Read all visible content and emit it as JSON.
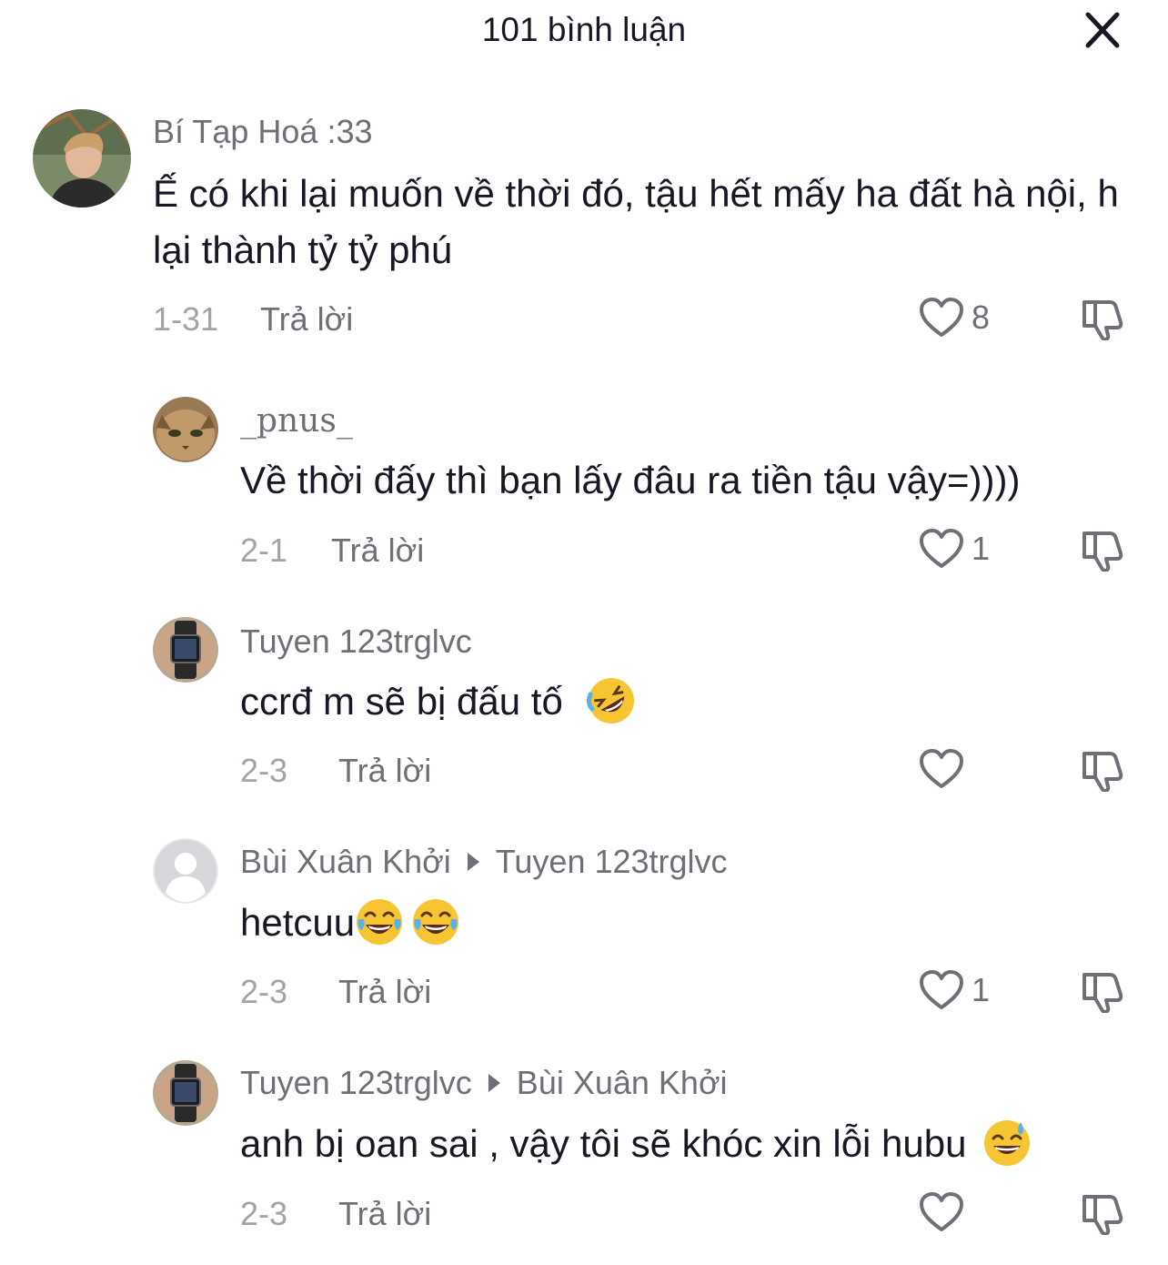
{
  "header": {
    "title": "101 bình luận"
  },
  "comments": [
    {
      "username": "Bí Tạp Hoá :33",
      "text": "Ế có khi lại muốn về thời đó, tậu hết mấy ha đất hà nội, h lại thành tỷ tỷ phú",
      "date": "1-31",
      "reply_label": "Trả lời",
      "likes": "8"
    },
    {
      "username": "_pnus_",
      "text": "Về thời đấy thì bạn lấy đâu ra tiền tậu vậy=))))",
      "date": "2-1",
      "reply_label": "Trả lời",
      "likes": "1"
    },
    {
      "username": "Tuyen 123trglvc",
      "text": "ccrđ m sẽ bị đấu tố",
      "emoji": "rolling-on-floor-laughing",
      "date": "2-3",
      "reply_label": "Trả lời",
      "likes": ""
    },
    {
      "username": "Bùi Xuân Khởi",
      "reply_to": "Tuyen 123trglvc",
      "text": "hetcuu",
      "emoji": "face-with-tears-of-joy",
      "date": "2-3",
      "reply_label": "Trả lời",
      "likes": "1"
    },
    {
      "username": "Tuyen 123trglvc",
      "reply_to": "Bùi Xuân Khởi",
      "text": "anh bị oan sai , vậy tôi sẽ khóc xin lỗi hubu",
      "emoji": "grinning-face-with-sweat",
      "date": "2-3",
      "reply_label": "Trả lời",
      "likes": ""
    }
  ],
  "icons": {
    "close": "close-icon",
    "like": "heart-outline-icon",
    "dislike": "thumbs-down-icon"
  }
}
